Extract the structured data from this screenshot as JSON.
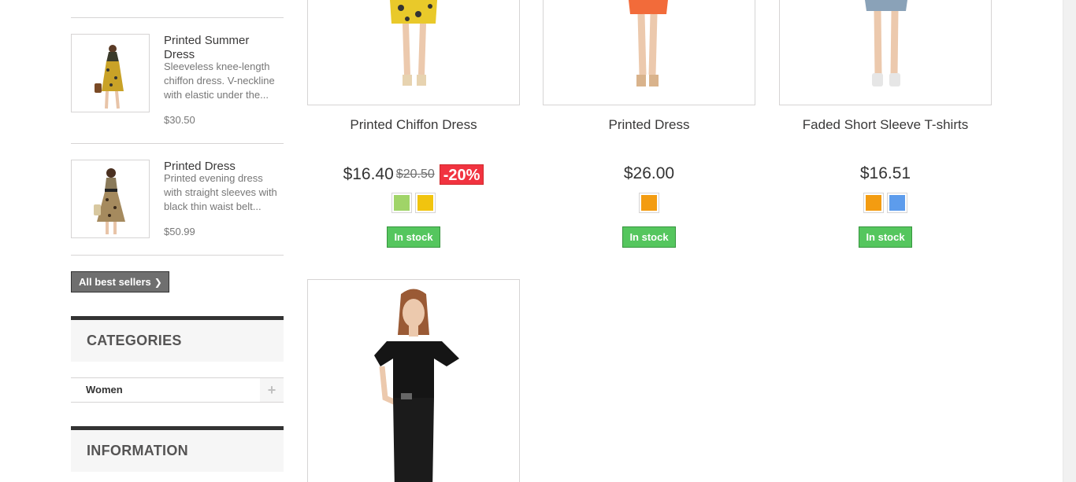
{
  "sidebar": {
    "best_sellers": [
      {
        "name": "Printed Summer Dress",
        "description": "Sleeveless knee-length chiffon dress. V-neckline with elastic under the...",
        "price": "$30.50"
      },
      {
        "name": "Printed Dress",
        "description": "Printed evening dress with straight sleeves with black thin waist belt...",
        "price": "$50.99"
      }
    ],
    "all_best_sellers_label": "All best sellers",
    "categories_title": "CATEGORIES",
    "categories": [
      {
        "label": "Women",
        "toggle": "+"
      }
    ],
    "information_title": "INFORMATION"
  },
  "products": [
    {
      "name": "Printed Chiffon Dress",
      "price": "$16.40",
      "old_price": "$20.50",
      "discount": "-20%",
      "swatches": [
        "#a0d468",
        "#f1c40f"
      ],
      "stock": "In stock"
    },
    {
      "name": "Printed Dress",
      "price": "$26.00",
      "swatches": [
        "#f39c11"
      ],
      "stock": "In stock"
    },
    {
      "name": "Faded Short Sleeve T-shirts",
      "price": "$16.51",
      "swatches": [
        "#f39c11",
        "#5d9cec"
      ],
      "stock": "In stock"
    }
  ],
  "colors": {
    "stock_green": "#55c65e",
    "discount_red": "#f13340",
    "button_gray": "#6f6f6f"
  }
}
